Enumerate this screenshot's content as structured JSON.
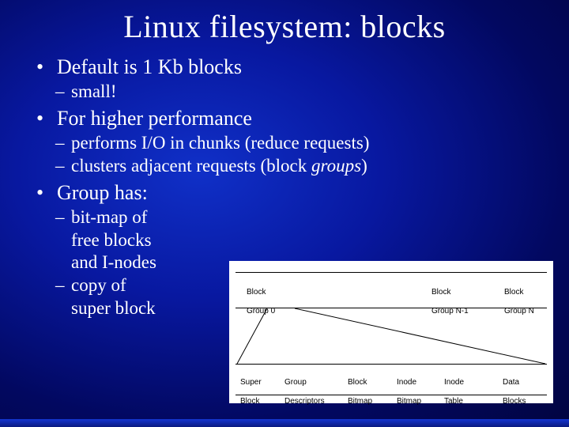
{
  "title": "Linux filesystem: blocks",
  "bullets": {
    "b1": {
      "text": "Default is 1 Kb blocks",
      "sub": {
        "s1": "small!"
      }
    },
    "b2": {
      "text": "For higher performance",
      "sub": {
        "s1": "performs I/O in chunks (reduce requests)",
        "s2_prefix": "clusters adjacent requests (block ",
        "s2_em": "groups",
        "s2_suffix": ")"
      }
    },
    "b3": {
      "text": "Group has:",
      "sub": {
        "s1": "bit-map of",
        "s2": "free blocks",
        "s3": "and I-nodes",
        "s4": "copy of",
        "s5": "super block"
      }
    }
  },
  "diagram": {
    "top": {
      "cellA_l1": "Block",
      "cellA_l2": "Group 0",
      "cellB_l1": "Block",
      "cellB_l2": "Group N-1",
      "cellC_l1": "Block",
      "cellC_l2": "Group N"
    },
    "bottom": {
      "c0_l1": "Super",
      "c0_l2": "Block",
      "c1_l1": "Group",
      "c1_l2": "Descriptors",
      "c2_l1": "Block",
      "c2_l2": "Bitmap",
      "c3_l1": "Inode",
      "c3_l2": "Bitmap",
      "c4_l1": "Inode",
      "c4_l2": "Table",
      "c5_l1": "Data",
      "c5_l2": "Blocks"
    }
  }
}
